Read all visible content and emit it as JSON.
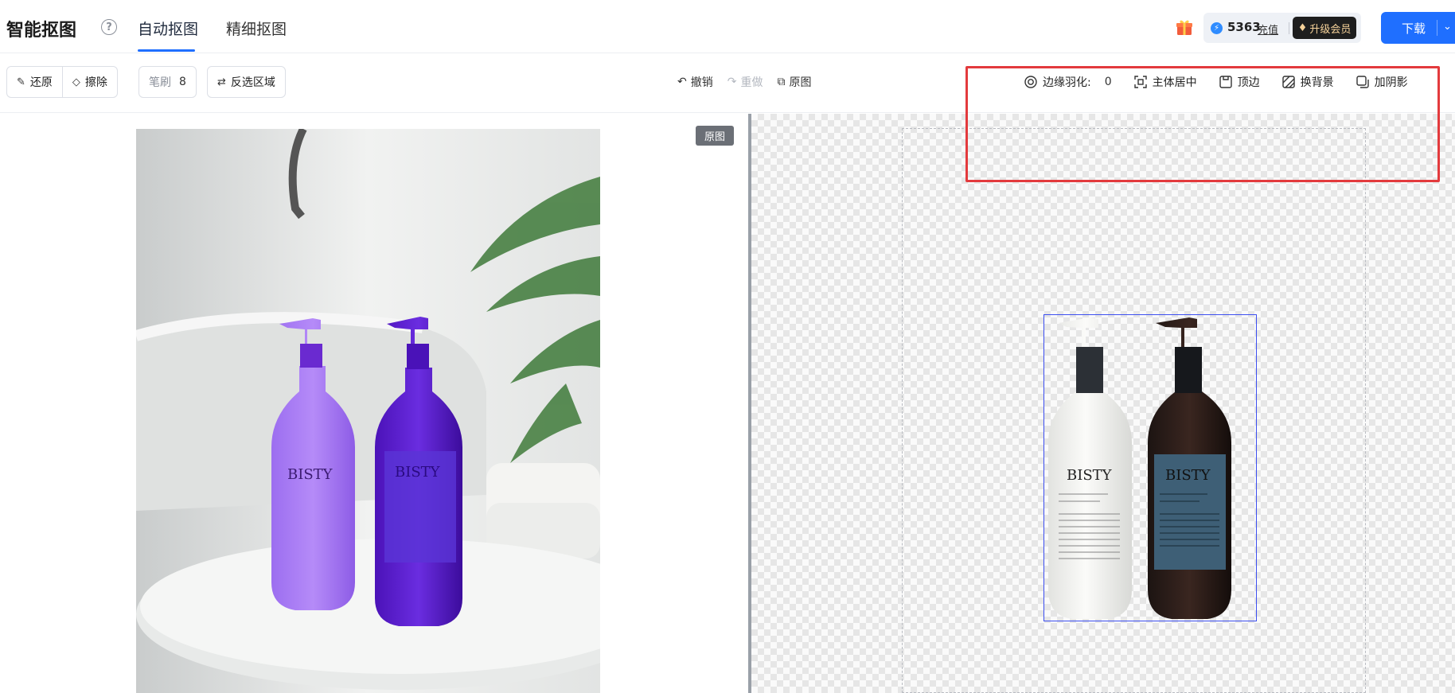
{
  "header": {
    "title": "智能抠图",
    "tabs": [
      {
        "label": "自动抠图",
        "active": true
      },
      {
        "label": "精细抠图",
        "active": false
      }
    ],
    "points": "5363",
    "recharge_label": "充值",
    "vip_label": "升级会员",
    "download_label": "下载"
  },
  "toolbar": {
    "restore_label": "还原",
    "erase_label": "擦除",
    "brush_label": "笔刷",
    "brush_value": "8",
    "invert_label": "反选区域",
    "undo_label": "撤销",
    "redo_label": "重做",
    "original_label": "原图",
    "feather_label": "边缘羽化:",
    "feather_value": "0",
    "center_label": "主体居中",
    "top_edge_label": "顶边",
    "change_bg_label": "换背景",
    "shadow_label": "加阴影"
  },
  "left_pane": {
    "badge": "原图",
    "bottle_brand": "BISTY"
  },
  "right_pane": {
    "bottle_brand": "BISTY"
  },
  "colors": {
    "accent": "#1f6fff",
    "highlight": "#e33a3d",
    "selection": "#3c4ef0"
  }
}
